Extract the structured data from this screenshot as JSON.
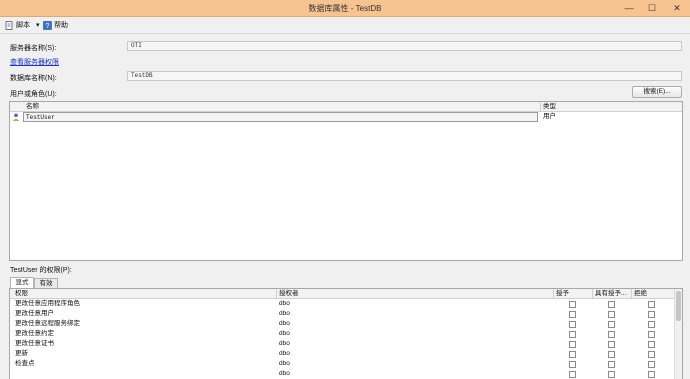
{
  "window": {
    "title": "数据库属性 - TestDB",
    "minimize_glyph": "—",
    "maximize_glyph": "☐",
    "close_glyph": "✕"
  },
  "toolbar": {
    "script_label": "脚本",
    "help_label": "帮助",
    "script_icon": "script-icon",
    "help_icon": "help-icon",
    "dropdown_glyph": "▾"
  },
  "form": {
    "server_name_label": "服务器名称(S):",
    "server_name_value": "OTI",
    "view_server_permissions_link": "查看服务器权限",
    "database_name_label": "数据库名称(N):",
    "database_name_value": "TestDB",
    "users_or_roles_label": "用户或角色(U):",
    "search_button_label": "搜索(E)..."
  },
  "users_grid": {
    "headers": {
      "name": "名称",
      "type": "类型"
    },
    "rows": [
      {
        "name": "TestUser",
        "type": "用户",
        "icon": "user-icon"
      }
    ]
  },
  "permissions": {
    "label": "TestUser 的权限(P):",
    "tabs": [
      {
        "label": "显式",
        "active": true
      },
      {
        "label": "有效",
        "active": false
      }
    ],
    "headers": {
      "permission": "权限",
      "grantor": "授权者",
      "grant": "授予",
      "with_grant": "具有授予...",
      "deny": "拒绝"
    },
    "rows": [
      {
        "permission": "更改任意应用程序角色",
        "grantor": "dbo"
      },
      {
        "permission": "更改任意用户",
        "grantor": "dbo"
      },
      {
        "permission": "更改任意远程服务绑定",
        "grantor": "dbo"
      },
      {
        "permission": "更改任意约定",
        "grantor": "dbo"
      },
      {
        "permission": "更改任意证书",
        "grantor": "dbo"
      },
      {
        "permission": "更新",
        "grantor": "dbo"
      },
      {
        "permission": "检查点",
        "grantor": "dbo"
      },
      {
        "permission": "",
        "grantor": "dbo"
      }
    ]
  }
}
